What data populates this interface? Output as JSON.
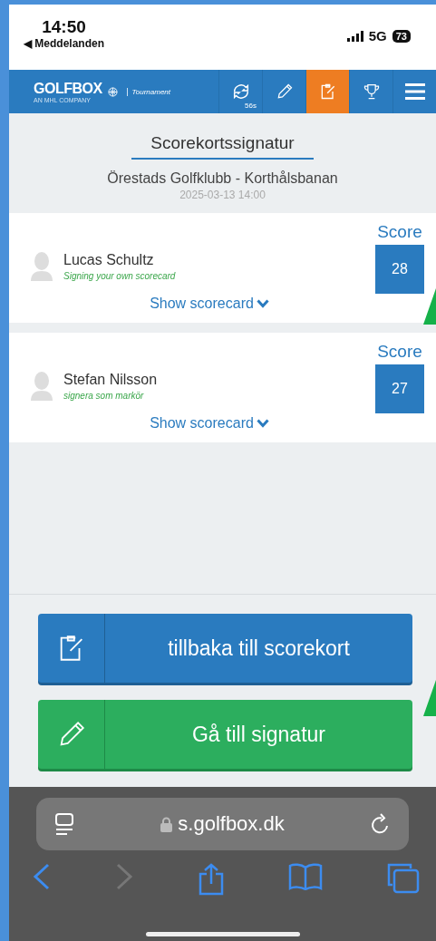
{
  "status_bar": {
    "time": "14:50",
    "back_label": "◀ Meddelanden",
    "network": "5G",
    "battery": "73"
  },
  "header": {
    "logo": "GOLFBOX",
    "tagline": "AN MHL COMPANY",
    "product": "Tournament",
    "nav": [
      {
        "kind": "refresh",
        "badge": "56s",
        "selected": false
      },
      {
        "kind": "pencil",
        "selected": false
      },
      {
        "kind": "scorecard",
        "selected": true
      },
      {
        "kind": "trophy",
        "selected": false
      },
      {
        "kind": "menu",
        "selected": false
      }
    ]
  },
  "page": {
    "title": "Scorekortssignatur",
    "club": "Örestads Golfklubb - Korthålsbanan",
    "date": "2025-03-13 14:00"
  },
  "players": [
    {
      "name": "Lucas Schultz",
      "role": "Signing your own scorecard",
      "score_label": "Score",
      "score": "28",
      "link": "Show scorecard"
    },
    {
      "name": "Stefan Nilsson",
      "role": "signera som markör",
      "score_label": "Score",
      "score": "27",
      "link": "Show scorecard"
    }
  ],
  "buttons": [
    {
      "kind": "back",
      "label": "tillbaka till scorekort"
    },
    {
      "kind": "sign",
      "label": "Gå till signatur"
    }
  ],
  "browser": {
    "url": "s.golfbox.dk"
  }
}
